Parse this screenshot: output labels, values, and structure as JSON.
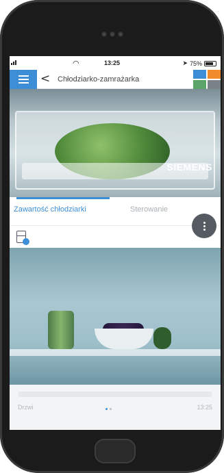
{
  "status_bar": {
    "time": "13:25",
    "battery": "75%"
  },
  "nav": {
    "back_glyph": "<",
    "title": "Chłodziarko-zamrażarka"
  },
  "hero": {
    "brand": "SIEMENS"
  },
  "tabs": [
    {
      "label": "Zawartość chłodziarki",
      "active": true
    },
    {
      "label": "Sterowanie",
      "active": false
    }
  ],
  "footer": {
    "left_label": "Drzwi",
    "right_label": "13:25"
  },
  "colors": {
    "accent": "#3c8fd6",
    "tile_blue": "#3d8ed7",
    "tile_orange": "#f08a2b",
    "tile_green": "#5aa469",
    "tile_gray": "#7a8288"
  },
  "icons": [
    "menu-icon",
    "back-chevron-icon",
    "fridge-icon",
    "more-options-icon",
    "wifi-icon",
    "signal-icon",
    "battery-icon",
    "location-arrow-icon"
  ]
}
